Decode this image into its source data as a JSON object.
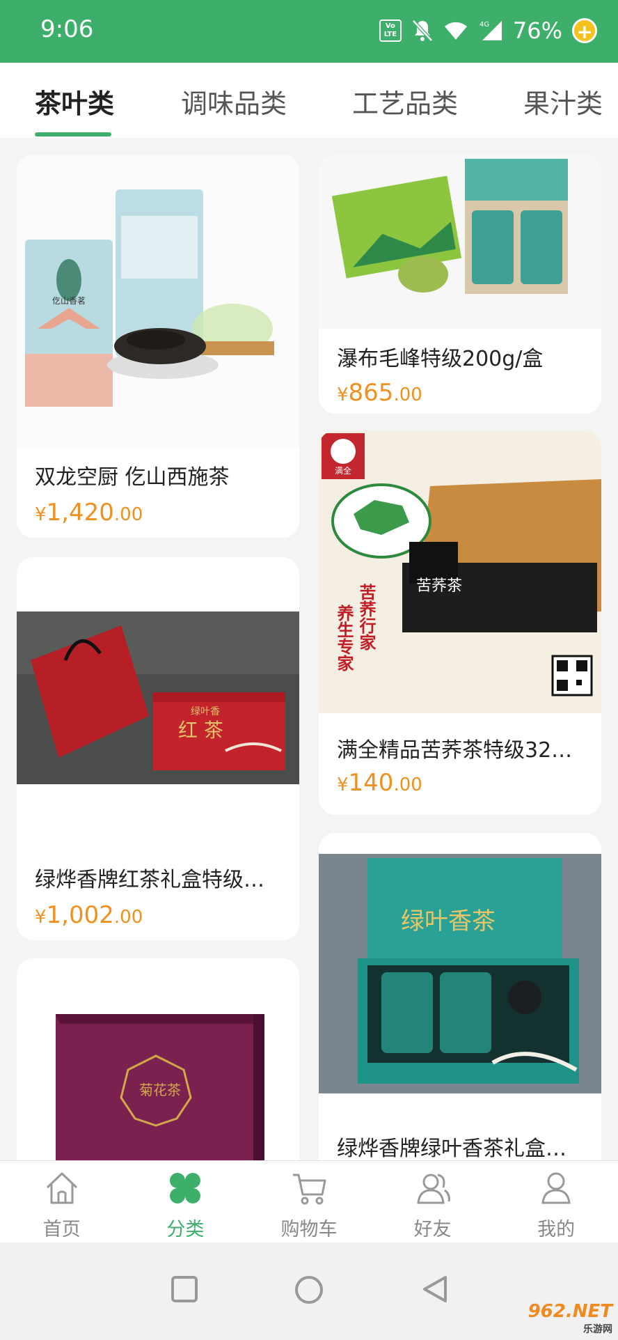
{
  "status_bar": {
    "time": "9:06",
    "volte_label": "Vo LTE",
    "network": "4G",
    "battery": "76%"
  },
  "tabs": [
    {
      "label": "茶叶类",
      "active": true
    },
    {
      "label": "调味品类",
      "active": false
    },
    {
      "label": "工艺品类",
      "active": false
    },
    {
      "label": "果汁类",
      "active": false
    }
  ],
  "products": [
    {
      "title": "双龙空厨 仡山西施茶",
      "currency": "¥",
      "price_int": "1,420",
      "price_dec": ".00"
    },
    {
      "title": "瀑布毛峰特级200g/盒",
      "currency": "¥",
      "price_int": "865",
      "price_dec": ".00"
    },
    {
      "title": "满全精品苦荞茶特级32…",
      "currency": "¥",
      "price_int": "140",
      "price_dec": ".00"
    },
    {
      "title": "绿烨香牌红茶礼盒特级…",
      "currency": "¥",
      "price_int": "1,002",
      "price_dec": ".00"
    },
    {
      "title": "绿烨香牌绿叶香茶礼盒…",
      "currency": "¥",
      "price_int": "",
      "price_dec": ""
    },
    {
      "title": "",
      "currency": "",
      "price_int": "",
      "price_dec": ""
    }
  ],
  "image_text": {
    "red_box": "红 茶",
    "red_box_brand": "绿叶香",
    "teal_box": "绿叶香茶",
    "buckwheat_brand": "满全",
    "buckwheat_slogan1": "苦荞行家",
    "buckwheat_slogan2": "养生专家",
    "buckwheat_product": "苦荞茶",
    "purple_box": "菊花茶",
    "tea_can_label": "仡山香茗"
  },
  "bottom_nav": [
    {
      "label": "首页",
      "icon": "home-icon",
      "active": false
    },
    {
      "label": "分类",
      "icon": "category-icon",
      "active": true
    },
    {
      "label": "购物车",
      "icon": "cart-icon",
      "active": false
    },
    {
      "label": "好友",
      "icon": "friends-icon",
      "active": false
    },
    {
      "label": "我的",
      "icon": "profile-icon",
      "active": false
    }
  ],
  "watermark": {
    "brand": "962.NET",
    "sub": "乐游网"
  },
  "colors": {
    "brand_green": "#3daf6a",
    "price_orange": "#f0901e",
    "background": "#f4f4f4"
  }
}
